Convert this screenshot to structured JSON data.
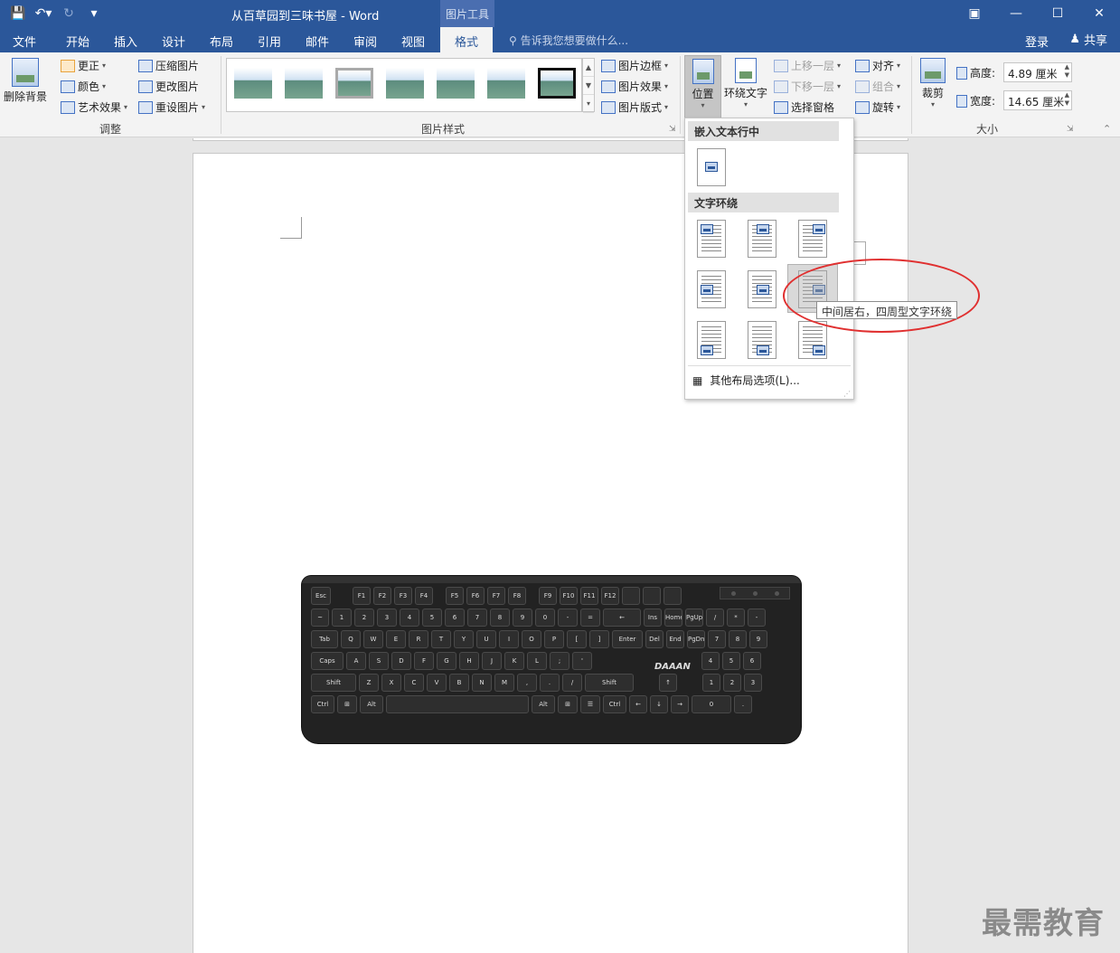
{
  "titlebar": {
    "doc_title": "从百草园到三味书屋 - Word",
    "tools_context": "图片工具"
  },
  "tabs": {
    "file": "文件",
    "home": "开始",
    "insert": "插入",
    "design": "设计",
    "layout": "布局",
    "references": "引用",
    "mailings": "邮件",
    "review": "审阅",
    "view": "视图",
    "format": "格式",
    "tell_me": "告诉我您想要做什么...",
    "login": "登录",
    "share": "共享"
  },
  "ribbon": {
    "adjust": {
      "remove_bg": "删除背景",
      "corrections": "更正",
      "color": "颜色",
      "artistic": "艺术效果",
      "compress": "压缩图片",
      "change": "更改图片",
      "reset": "重设图片",
      "label": "调整"
    },
    "styles": {
      "border": "图片边框",
      "effects": "图片效果",
      "layout": "图片版式",
      "label": "图片样式"
    },
    "arrange": {
      "position": "位置",
      "wrap_text": "环绕文字",
      "bring_forward": "上移一层",
      "send_backward": "下移一层",
      "selection_pane": "选择窗格",
      "align": "对齐",
      "group": "组合",
      "rotate": "旋转"
    },
    "size": {
      "crop": "裁剪",
      "height_label": "高度:",
      "height_value": "4.89 厘米",
      "width_label": "宽度:",
      "width_value": "14.65 厘米",
      "label": "大小"
    }
  },
  "position_menu": {
    "inline_header": "嵌入文本行中",
    "wrap_header": "文字环绕",
    "more_options": "其他布局选项(L)...",
    "tooltip": "中间居右，四周型文字环绕"
  },
  "keyboard_brand": "DAAAN",
  "watermark": "最需教育"
}
